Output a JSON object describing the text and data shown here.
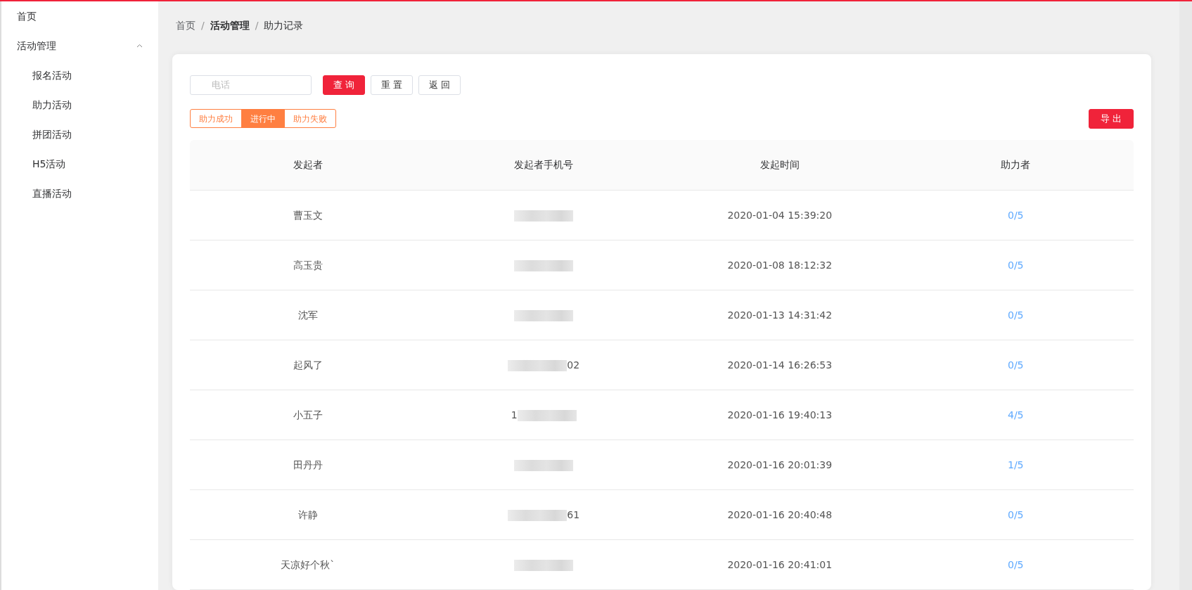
{
  "sidebar": {
    "items": [
      {
        "label": "首页"
      },
      {
        "label": "活动管理",
        "expanded": true,
        "children": [
          {
            "label": "报名活动"
          },
          {
            "label": "助力活动"
          },
          {
            "label": "拼团活动"
          },
          {
            "label": "H5活动"
          },
          {
            "label": "直播活动"
          }
        ]
      }
    ]
  },
  "breadcrumb": [
    {
      "label": "首页",
      "current": false
    },
    {
      "label": "活动管理",
      "current": false
    },
    {
      "label": "助力记录",
      "current": true
    }
  ],
  "breadcrumb_separator": "/",
  "search": {
    "placeholder": "电话"
  },
  "buttons": [
    {
      "label": "查 询",
      "kind": "primary"
    },
    {
      "label": "重 置",
      "kind": "plain"
    },
    {
      "label": "返 回",
      "kind": "plain"
    }
  ],
  "status_tabs": [
    {
      "label": "助力成功",
      "selected": false
    },
    {
      "label": "进行中",
      "selected": true
    },
    {
      "label": "助力失败",
      "selected": false
    }
  ],
  "export_button": {
    "label": "导 出"
  },
  "table": {
    "columns": [
      "发起者",
      "发起者手机号",
      "发起时间",
      "助力者"
    ],
    "rows": [
      {
        "initiator": "曹玉文",
        "phone_prefix": "",
        "phone_suffix": "",
        "time": "2020-01-04 15:39:20",
        "helpers": "0/5"
      },
      {
        "initiator": "高玉贵",
        "phone_prefix": "",
        "phone_suffix": "",
        "time": "2020-01-08 18:12:32",
        "helpers": "0/5"
      },
      {
        "initiator": "沈军",
        "phone_prefix": "",
        "phone_suffix": "",
        "time": "2020-01-13 14:31:42",
        "helpers": "0/5"
      },
      {
        "initiator": "起风了",
        "phone_prefix": "",
        "phone_suffix": "02",
        "time": "2020-01-14 16:26:53",
        "helpers": "0/5"
      },
      {
        "initiator": "小五子",
        "phone_prefix": "1",
        "phone_suffix": "",
        "time": "2020-01-16 19:40:13",
        "helpers": "4/5"
      },
      {
        "initiator": "田丹丹",
        "phone_prefix": "",
        "phone_suffix": "",
        "time": "2020-01-16 20:01:39",
        "helpers": "1/5"
      },
      {
        "initiator": "许静",
        "phone_prefix": "",
        "phone_suffix": "61",
        "time": "2020-01-16 20:40:48",
        "helpers": "0/5"
      },
      {
        "initiator": "天凉好个秋`",
        "phone_prefix": "",
        "phone_suffix": "",
        "time": "2020-01-16 20:41:01",
        "helpers": "0/5"
      }
    ]
  }
}
